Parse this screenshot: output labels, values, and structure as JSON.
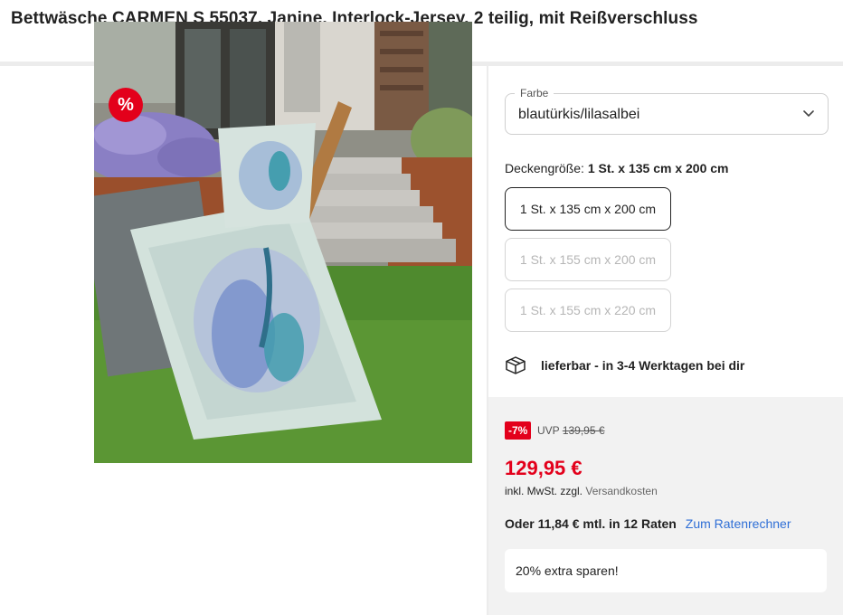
{
  "product": {
    "title": "Bettwäsche CARMEN S 55037, Janine, Interlock-Jersey, 2 teilig, mit Reißverschluss",
    "badge": "%"
  },
  "color_select": {
    "legend": "Farbe",
    "value": "blautürkis/lilasalbei"
  },
  "size": {
    "label_prefix": "Deckengröße:",
    "label_value": "1 St. x 135 cm x 200 cm",
    "options": [
      {
        "label": "1 St. x 135 cm x 200 cm",
        "state": "selected"
      },
      {
        "label": "1 St. x 155 cm x 200 cm",
        "state": "unavailable"
      },
      {
        "label": "1 St. x 155 cm x 220 cm",
        "state": "unavailable"
      }
    ]
  },
  "delivery": {
    "icon": "package-icon",
    "text": "lieferbar - in 3-4 Werktagen bei dir"
  },
  "pricing": {
    "discount": "-7%",
    "uvp_label": "UVP",
    "uvp_value": "139,95 €",
    "price": "129,95 €",
    "tax_text": "inkl. MwSt. zzgl.",
    "shipping_link": "Versandkosten",
    "installment_text": "Oder 11,84 € mtl. in 12 Raten",
    "installment_link": "Zum Ratenrechner",
    "promo_text": "20% extra sparen!"
  },
  "colors": {
    "accent_red": "#e3001b",
    "link_blue": "#2f6fd6",
    "panel_gray": "#f2f2f2"
  }
}
